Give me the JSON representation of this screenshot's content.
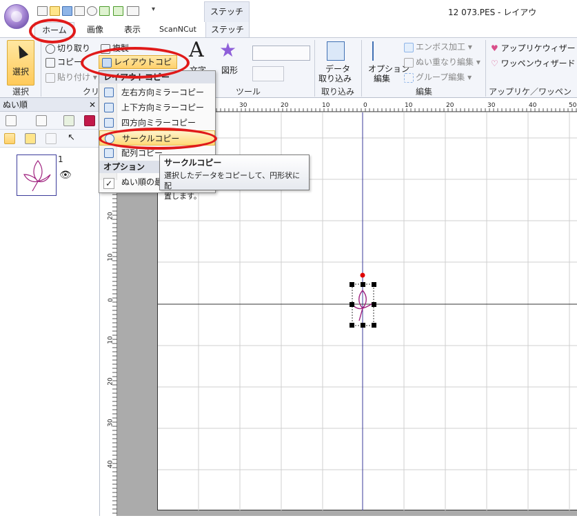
{
  "window_title": "12 073.PES - レイアウ",
  "context_tab_header": "ステッチ",
  "tabs": [
    "ホーム",
    "画像",
    "表示",
    "ScanNCut",
    "ステッチ"
  ],
  "ribbon": {
    "select_label": "選択",
    "group_select": "選択",
    "group_clipboard": "クリ",
    "group_tools": "ツール",
    "group_import": "取り込み",
    "group_edit": "編集",
    "group_applique": "アップリケ／ワッペン",
    "cut": "切り取り",
    "copy": "コピー",
    "paste": "貼り付け",
    "duplicate": "複製",
    "layout_copy": "レイアウトコピー",
    "text": "文字",
    "shapes": "図形",
    "data_import_1": "データ",
    "data_import_2": "取り込み",
    "option_edit_1": "オプション",
    "option_edit_2": "編集",
    "emboss": "エンボス加工",
    "stitch_overlap": "ぬい重なり編集",
    "group_edit_btn": "グループ編集",
    "applique_wizard": "アップリケウィザード",
    "patch_wizard": "ワッペンウィザード"
  },
  "dropdown": {
    "header": "レイアウトコピー",
    "items": [
      "左右方向ミラーコピー",
      "上下方向ミラーコピー",
      "四方向ミラーコピー",
      "サークルコピー",
      "配列コピー"
    ],
    "options_header": "オプション",
    "option_item": "ぬい順の最"
  },
  "tooltip": {
    "title": "サークルコピー",
    "body_line1": "選択したデータをコピーして、円形状に配",
    "body_line2": "置します。"
  },
  "panel": {
    "title": "ぬい順",
    "item_number": "1"
  },
  "ruler_top_labels": [
    "30",
    "20",
    "10",
    "0",
    "10",
    "20",
    "30",
    "40",
    "50"
  ],
  "ruler_left_labels": [
    "20",
    "10",
    "0",
    "10",
    "20",
    "30",
    "40"
  ],
  "colors": {
    "highlight_circle": "#e01a1a",
    "selected_button": "#ffd06b",
    "design_stroke": "#a0227f",
    "rotation_handle": "#e00000"
  }
}
